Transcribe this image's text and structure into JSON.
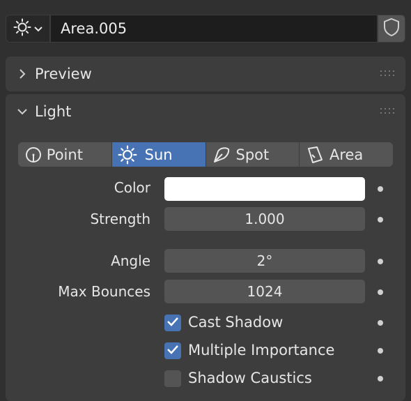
{
  "datablock": {
    "type_icon": "sun-icon",
    "name": "Area.005",
    "fake_user_icon": "shield-icon"
  },
  "preview_panel": {
    "title": "Preview",
    "expanded": false
  },
  "light_panel": {
    "title": "Light",
    "expanded": true,
    "types": [
      {
        "label": "Point",
        "icon": "point-light-icon",
        "active": false
      },
      {
        "label": "Sun",
        "icon": "sun-icon",
        "active": true
      },
      {
        "label": "Spot",
        "icon": "spot-light-icon",
        "active": false
      },
      {
        "label": "Area",
        "icon": "area-light-icon",
        "active": false
      }
    ],
    "color": {
      "label": "Color",
      "value": "#ffffff"
    },
    "strength": {
      "label": "Strength",
      "value": "1.000"
    },
    "angle": {
      "label": "Angle",
      "value": "2°"
    },
    "max_bounces": {
      "label": "Max Bounces",
      "value": "1024"
    },
    "cast_shadow": {
      "label": "Cast Shadow",
      "checked": true
    },
    "multiple_importance": {
      "label": "Multiple Importance",
      "checked": true
    },
    "shadow_caustics": {
      "label": "Shadow Caustics",
      "checked": false
    }
  },
  "colors": {
    "accent": "#4772b3",
    "panel": "#3d3d3d",
    "background": "#303030",
    "field": "#545454"
  }
}
